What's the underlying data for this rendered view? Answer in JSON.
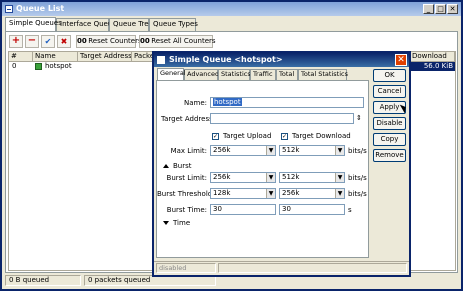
{
  "window": {
    "title": "Queue List",
    "min_label": "_",
    "max_label": "□",
    "close_label": "✕"
  },
  "tabs": [
    "Simple Queues",
    "Interface Queues",
    "Queue Tree",
    "Queue Types"
  ],
  "toolbar": {
    "reset_counters": "Reset Counters",
    "reset_all_counters": "Reset All Counters",
    "add": "+",
    "remove": "−",
    "enable": "✔",
    "disable": "✖"
  },
  "table": {
    "columns": [
      "#",
      "Name",
      "Target Address",
      "Packet",
      "Download"
    ],
    "rows": [
      {
        "index": "0",
        "name": "hotspot",
        "download_value": "56.0 KiB"
      }
    ]
  },
  "statusbar": {
    "left": "0 B queued",
    "right": "0 packets queued"
  },
  "dialog": {
    "title": "Simple Queue <hotspot>",
    "close_label": "✕",
    "tabs": [
      "General",
      "Advanced",
      "Statistics",
      "Traffic",
      "Total",
      "Total Statistics"
    ],
    "name_label": "Name:",
    "name_value": "hotspot",
    "target_address_label": "Target Address:",
    "target_upload_label": "Target Upload",
    "target_download_label": "Target Download",
    "max_limit_label": "Max Limit:",
    "max_limit_upload": "256k",
    "max_limit_download": "512k",
    "bits_unit": "bits/s",
    "burst_section": "Burst",
    "burst_limit_label": "Burst Limit:",
    "burst_limit_upload": "256k",
    "burst_limit_download": "512k",
    "burst_threshold_label": "Burst Threshold:",
    "burst_threshold_upload": "128k",
    "burst_threshold_download": "256k",
    "burst_time_label": "Burst Time:",
    "burst_time_upload": "30",
    "burst_time_download": "30",
    "seconds_unit": "s",
    "time_section": "Time",
    "buttons": [
      "OK",
      "Cancel",
      "Apply",
      "Disable",
      "Copy",
      "Remove"
    ],
    "status": "disabled"
  }
}
